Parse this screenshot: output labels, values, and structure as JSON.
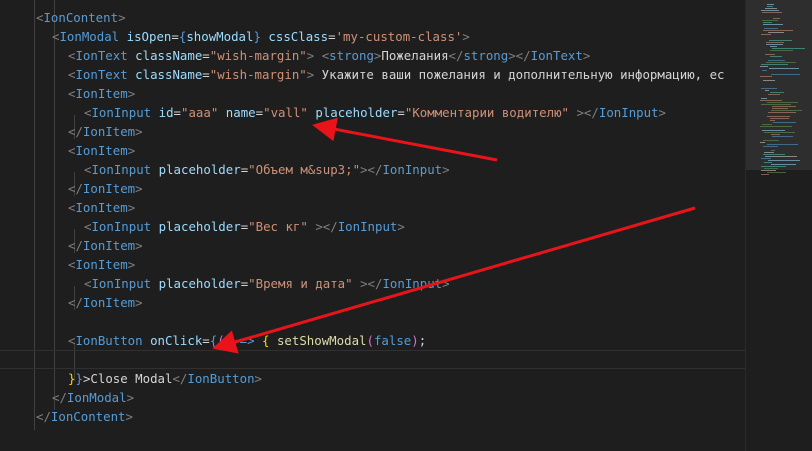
{
  "editor": {
    "lines": [
      [
        {
          "c": "ta",
          "t": "<"
        },
        {
          "c": "t",
          "t": "IonContent"
        },
        {
          "c": "ta",
          "t": ">"
        }
      ],
      [
        {
          "c": "ta",
          "t": "<"
        },
        {
          "c": "t",
          "t": "IonModal"
        },
        {
          "c": "tx",
          "t": " "
        },
        {
          "c": "at",
          "t": "isOpen"
        },
        {
          "c": "tx",
          "t": "="
        },
        {
          "c": "t",
          "t": "{"
        },
        {
          "c": "at",
          "t": "showModal"
        },
        {
          "c": "t",
          "t": "}"
        },
        {
          "c": "tx",
          "t": " "
        },
        {
          "c": "at",
          "t": "cssClass"
        },
        {
          "c": "tx",
          "t": "="
        },
        {
          "c": "st",
          "t": "'my-custom-class'"
        },
        {
          "c": "ta",
          "t": ">"
        }
      ],
      [
        {
          "c": "ta",
          "t": "<"
        },
        {
          "c": "t",
          "t": "IonText"
        },
        {
          "c": "tx",
          "t": " "
        },
        {
          "c": "at",
          "t": "className"
        },
        {
          "c": "tx",
          "t": "="
        },
        {
          "c": "st",
          "t": "\"wish-margin\""
        },
        {
          "c": "ta",
          "t": ">"
        },
        {
          "c": "tx",
          "t": " "
        },
        {
          "c": "ta",
          "t": "<"
        },
        {
          "c": "t",
          "t": "strong"
        },
        {
          "c": "ta",
          "t": ">"
        },
        {
          "c": "tx",
          "t": "Пожелания"
        },
        {
          "c": "ta",
          "t": "</"
        },
        {
          "c": "t",
          "t": "strong"
        },
        {
          "c": "ta",
          "t": "></"
        },
        {
          "c": "t",
          "t": "IonText"
        },
        {
          "c": "ta",
          "t": ">"
        }
      ],
      [
        {
          "c": "ta",
          "t": "<"
        },
        {
          "c": "t",
          "t": "IonText"
        },
        {
          "c": "tx",
          "t": " "
        },
        {
          "c": "at",
          "t": "className"
        },
        {
          "c": "tx",
          "t": "="
        },
        {
          "c": "st",
          "t": "\"wish-margin\""
        },
        {
          "c": "ta",
          "t": ">"
        },
        {
          "c": "tx",
          "t": " Укажите ваши пожелания и дополнительную информацию, ес"
        }
      ],
      [
        {
          "c": "ta",
          "t": "<"
        },
        {
          "c": "t",
          "t": "IonItem"
        },
        {
          "c": "ta",
          "t": ">"
        }
      ],
      [
        {
          "c": "ta",
          "t": "<"
        },
        {
          "c": "t",
          "t": "IonInput"
        },
        {
          "c": "tx",
          "t": " "
        },
        {
          "c": "at",
          "t": "id"
        },
        {
          "c": "tx",
          "t": "="
        },
        {
          "c": "st",
          "t": "\"aaa\""
        },
        {
          "c": "tx",
          "t": " "
        },
        {
          "c": "at",
          "t": "name"
        },
        {
          "c": "tx",
          "t": "="
        },
        {
          "c": "st",
          "t": "\"vall\""
        },
        {
          "c": "tx",
          "t": " "
        },
        {
          "c": "at",
          "t": "placeholder"
        },
        {
          "c": "tx",
          "t": "="
        },
        {
          "c": "st",
          "t": "\"Комментарии водителю\""
        },
        {
          "c": "tx",
          "t": " "
        },
        {
          "c": "ta",
          "t": "></"
        },
        {
          "c": "t",
          "t": "IonInput"
        },
        {
          "c": "ta",
          "t": ">"
        }
      ],
      [
        {
          "c": "ta",
          "t": "</"
        },
        {
          "c": "t",
          "t": "IonItem"
        },
        {
          "c": "ta",
          "t": ">"
        }
      ],
      [
        {
          "c": "ta",
          "t": "<"
        },
        {
          "c": "t",
          "t": "IonItem"
        },
        {
          "c": "ta",
          "t": ">"
        }
      ],
      [
        {
          "c": "ta",
          "t": "<"
        },
        {
          "c": "t",
          "t": "IonInput"
        },
        {
          "c": "tx",
          "t": " "
        },
        {
          "c": "at",
          "t": "placeholder"
        },
        {
          "c": "tx",
          "t": "="
        },
        {
          "c": "st",
          "t": "\"Объем м&sup3;\""
        },
        {
          "c": "ta",
          "t": "></"
        },
        {
          "c": "t",
          "t": "IonInput"
        },
        {
          "c": "ta",
          "t": ">"
        }
      ],
      [
        {
          "c": "ta",
          "t": "</"
        },
        {
          "c": "t",
          "t": "IonItem"
        },
        {
          "c": "ta",
          "t": ">"
        }
      ],
      [
        {
          "c": "ta",
          "t": "<"
        },
        {
          "c": "t",
          "t": "IonItem"
        },
        {
          "c": "ta",
          "t": ">"
        }
      ],
      [
        {
          "c": "ta",
          "t": "<"
        },
        {
          "c": "t",
          "t": "IonInput"
        },
        {
          "c": "tx",
          "t": " "
        },
        {
          "c": "at",
          "t": "placeholder"
        },
        {
          "c": "tx",
          "t": "="
        },
        {
          "c": "st",
          "t": "\"Вес кг\""
        },
        {
          "c": "tx",
          "t": " "
        },
        {
          "c": "ta",
          "t": "></"
        },
        {
          "c": "t",
          "t": "IonInput"
        },
        {
          "c": "ta",
          "t": ">"
        }
      ],
      [
        {
          "c": "ta",
          "t": "</"
        },
        {
          "c": "t",
          "t": "IonItem"
        },
        {
          "c": "ta",
          "t": ">"
        }
      ],
      [
        {
          "c": "ta",
          "t": "<"
        },
        {
          "c": "t",
          "t": "IonItem"
        },
        {
          "c": "ta",
          "t": ">"
        }
      ],
      [
        {
          "c": "ta",
          "t": "<"
        },
        {
          "c": "t",
          "t": "IonInput"
        },
        {
          "c": "tx",
          "t": " "
        },
        {
          "c": "at",
          "t": "placeholder"
        },
        {
          "c": "tx",
          "t": "="
        },
        {
          "c": "st",
          "t": "\"Время и дата\""
        },
        {
          "c": "tx",
          "t": " "
        },
        {
          "c": "ta",
          "t": "></"
        },
        {
          "c": "t",
          "t": "IonInput"
        },
        {
          "c": "ta",
          "t": ">"
        }
      ],
      [
        {
          "c": "ta",
          "t": "</"
        },
        {
          "c": "t",
          "t": "IonItem"
        },
        {
          "c": "ta",
          "t": ">"
        }
      ],
      [],
      [
        {
          "c": "ta",
          "t": "<"
        },
        {
          "c": "t",
          "t": "IonButton"
        },
        {
          "c": "tx",
          "t": " "
        },
        {
          "c": "at",
          "t": "onClick"
        },
        {
          "c": "tx",
          "t": "="
        },
        {
          "c": "t",
          "t": "{"
        },
        {
          "c": "br2",
          "t": "("
        },
        {
          "c": "br2",
          "t": ")"
        },
        {
          "c": "tx",
          "t": " "
        },
        {
          "c": "t",
          "t": "=>"
        },
        {
          "c": "tx",
          "t": " "
        },
        {
          "c": "br",
          "t": "{"
        },
        {
          "c": "tx",
          "t": " "
        },
        {
          "c": "fn",
          "t": "setShowModal"
        },
        {
          "c": "br2",
          "t": "("
        },
        {
          "c": "t",
          "t": "false"
        },
        {
          "c": "br2",
          "t": ")"
        },
        {
          "c": "tx",
          "t": ";"
        }
      ],
      [],
      [
        {
          "c": "br",
          "t": "}"
        },
        {
          "c": "t",
          "t": "}"
        },
        {
          "c": "tx",
          "t": ">Close Modal"
        },
        {
          "c": "ta",
          "t": "</"
        },
        {
          "c": "t",
          "t": "IonButton"
        },
        {
          "c": "ta",
          "t": ">"
        }
      ],
      [
        {
          "c": "ta",
          "t": "</"
        },
        {
          "c": "t",
          "t": "IonModal"
        },
        {
          "c": "ta",
          "t": ">"
        }
      ],
      [
        {
          "c": "ta",
          "t": "</"
        },
        {
          "c": "t",
          "t": "IonContent"
        },
        {
          "c": "ta",
          "t": ">"
        }
      ]
    ]
  },
  "annotations": {
    "arrow_color": "#e8141a"
  }
}
